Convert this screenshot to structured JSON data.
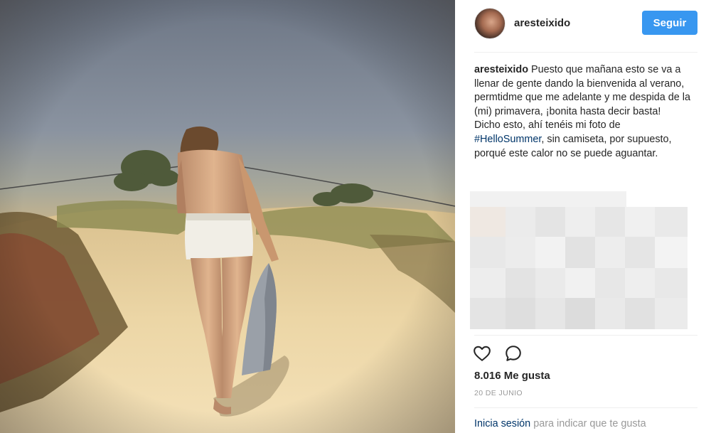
{
  "post": {
    "username": "aresteixido",
    "follow_label": "Seguir",
    "caption": {
      "username": "aresteixido",
      "text_1": " Puesto que mañana esto se va a llenar de gente dando la bienvenida al verano, permtidme que me adelante y me despida de la (mi) primavera, ¡bonita hasta decir basta!",
      "text_2": "Dicho esto, ahí tenéis mi foto de ",
      "hashtag": "#HelloSummer",
      "text_3": ", sin camiseta, por supuesto, porqué este calor no se puede aguantar."
    },
    "likes": "8.016 Me gusta",
    "date": "20 DE JUNIO",
    "login": {
      "link": "Inicia sesión",
      "rest": " para indicar que te gusta"
    }
  },
  "icons": {
    "like": "heart-icon",
    "comment": "comment-icon"
  },
  "colors": {
    "follow_button": "#3897f0",
    "link": "#003569",
    "muted": "#999999"
  }
}
